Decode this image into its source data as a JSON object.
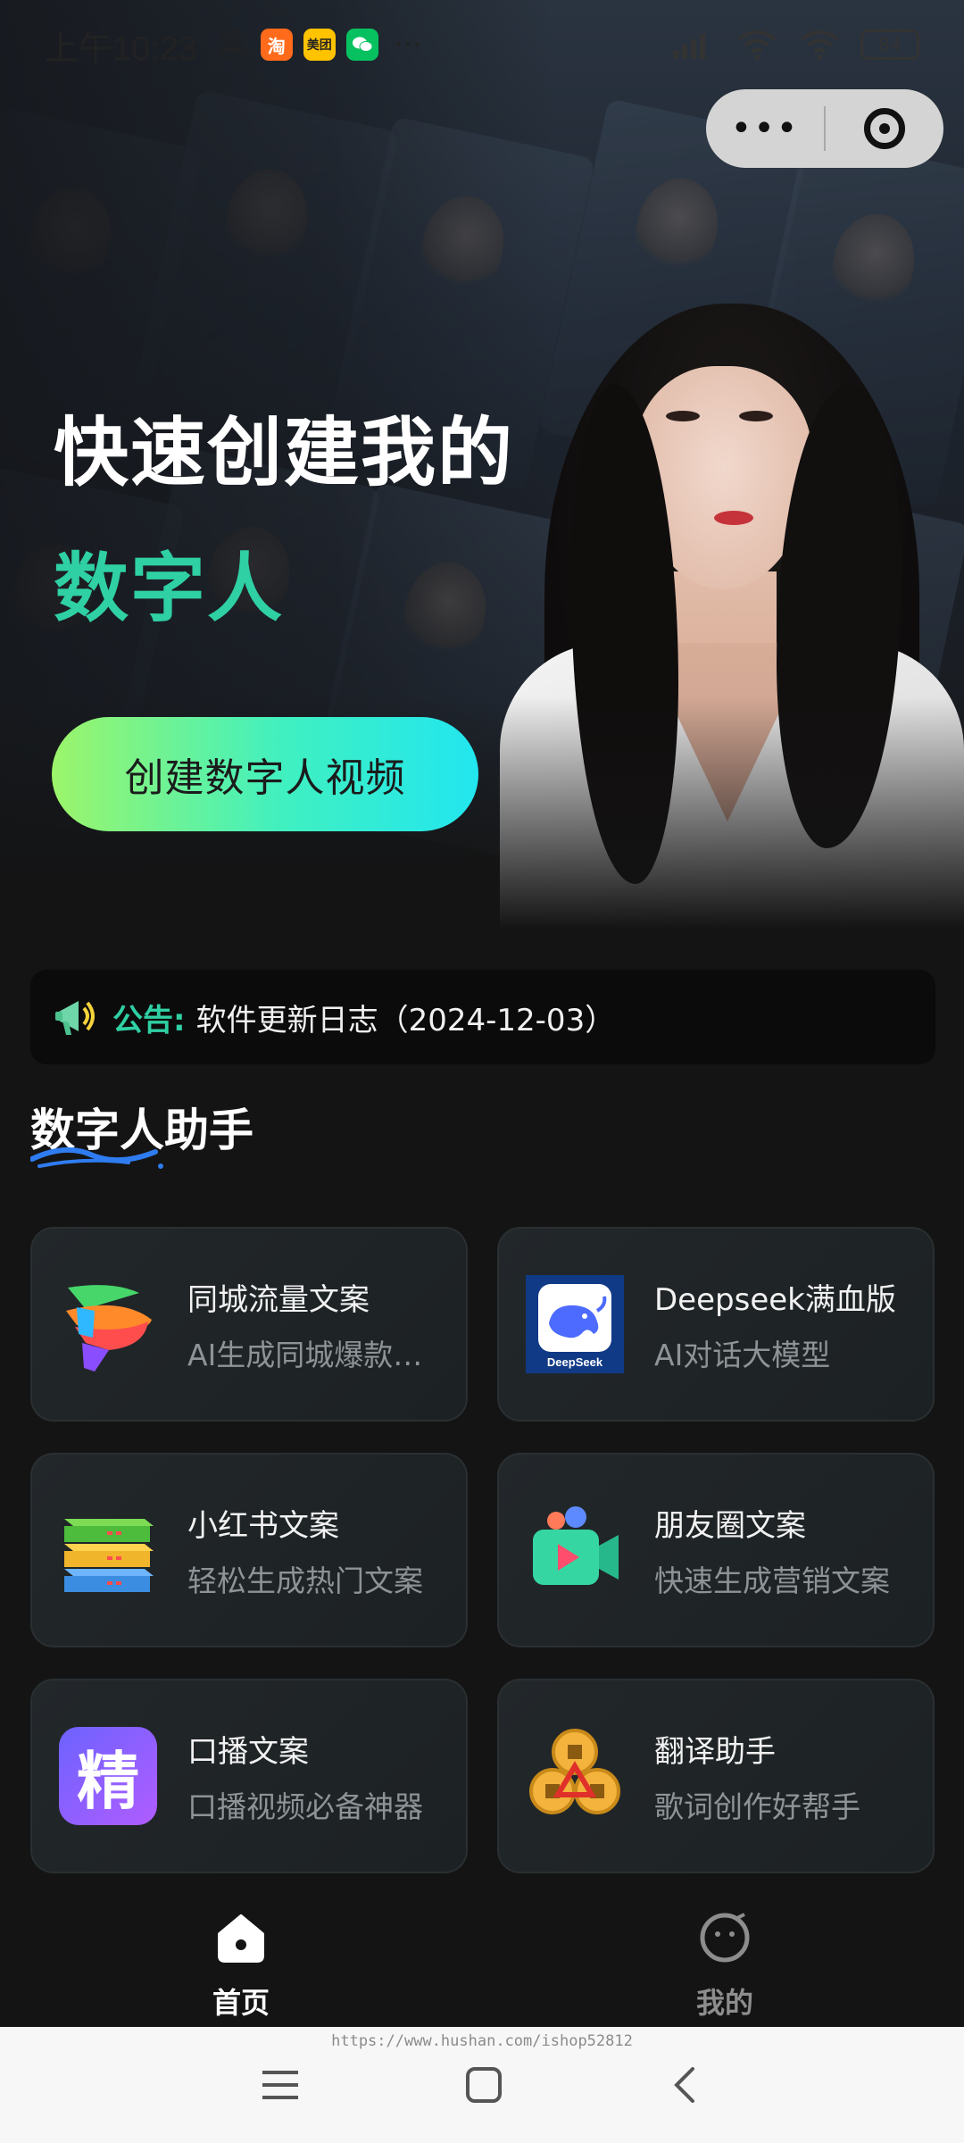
{
  "status_bar": {
    "time": "上午10:23",
    "apps": [
      {
        "name": "taobao-icon",
        "label": "淘",
        "color": "#ff6a1b"
      },
      {
        "name": "meituan-icon",
        "label": "美团",
        "color": "#ffc300"
      },
      {
        "name": "wechat-icon",
        "label": "",
        "color": "#07c160"
      }
    ],
    "more": "···",
    "battery": "84"
  },
  "capsule": {
    "more": "•••"
  },
  "hero": {
    "title_line1": "快速创建我的",
    "title_line2": "数字人",
    "cta": "创建数字人视频"
  },
  "notice": {
    "label": "公告:",
    "text": "软件更新日志（2024-12-03）"
  },
  "section": {
    "title": "数字人助手"
  },
  "cards": [
    {
      "title": "同城流量文案",
      "subtitle": "AI生成同城爆款…",
      "icon": "colorful-p-icon"
    },
    {
      "title": "Deepseek满血版",
      "subtitle": "AI对话大模型",
      "icon": "deepseek-whale-icon",
      "icon_text": "DeepSeek"
    },
    {
      "title": "小红书文案",
      "subtitle": "轻松生成热门文案",
      "icon": "stacked-books-icon"
    },
    {
      "title": "朋友圈文案",
      "subtitle": "快速生成营销文案",
      "icon": "video-camera-icon"
    },
    {
      "title": "口播文案",
      "subtitle": "口播视频必备神器",
      "icon": "jing-character-icon",
      "icon_text": "精"
    },
    {
      "title": "翻译助手",
      "subtitle": "歌词创作好帮手",
      "icon": "gold-coins-icon"
    }
  ],
  "bottom_nav": {
    "items": [
      {
        "label": "首页",
        "active": true
      },
      {
        "label": "我的",
        "active": false
      }
    ]
  },
  "watermark": "https://www.hushan.com/ishop52812",
  "colors": {
    "accent": "#2fd0a4",
    "background": "#141414",
    "cta_start": "#9cf56a",
    "cta_end": "#22e6f0"
  }
}
